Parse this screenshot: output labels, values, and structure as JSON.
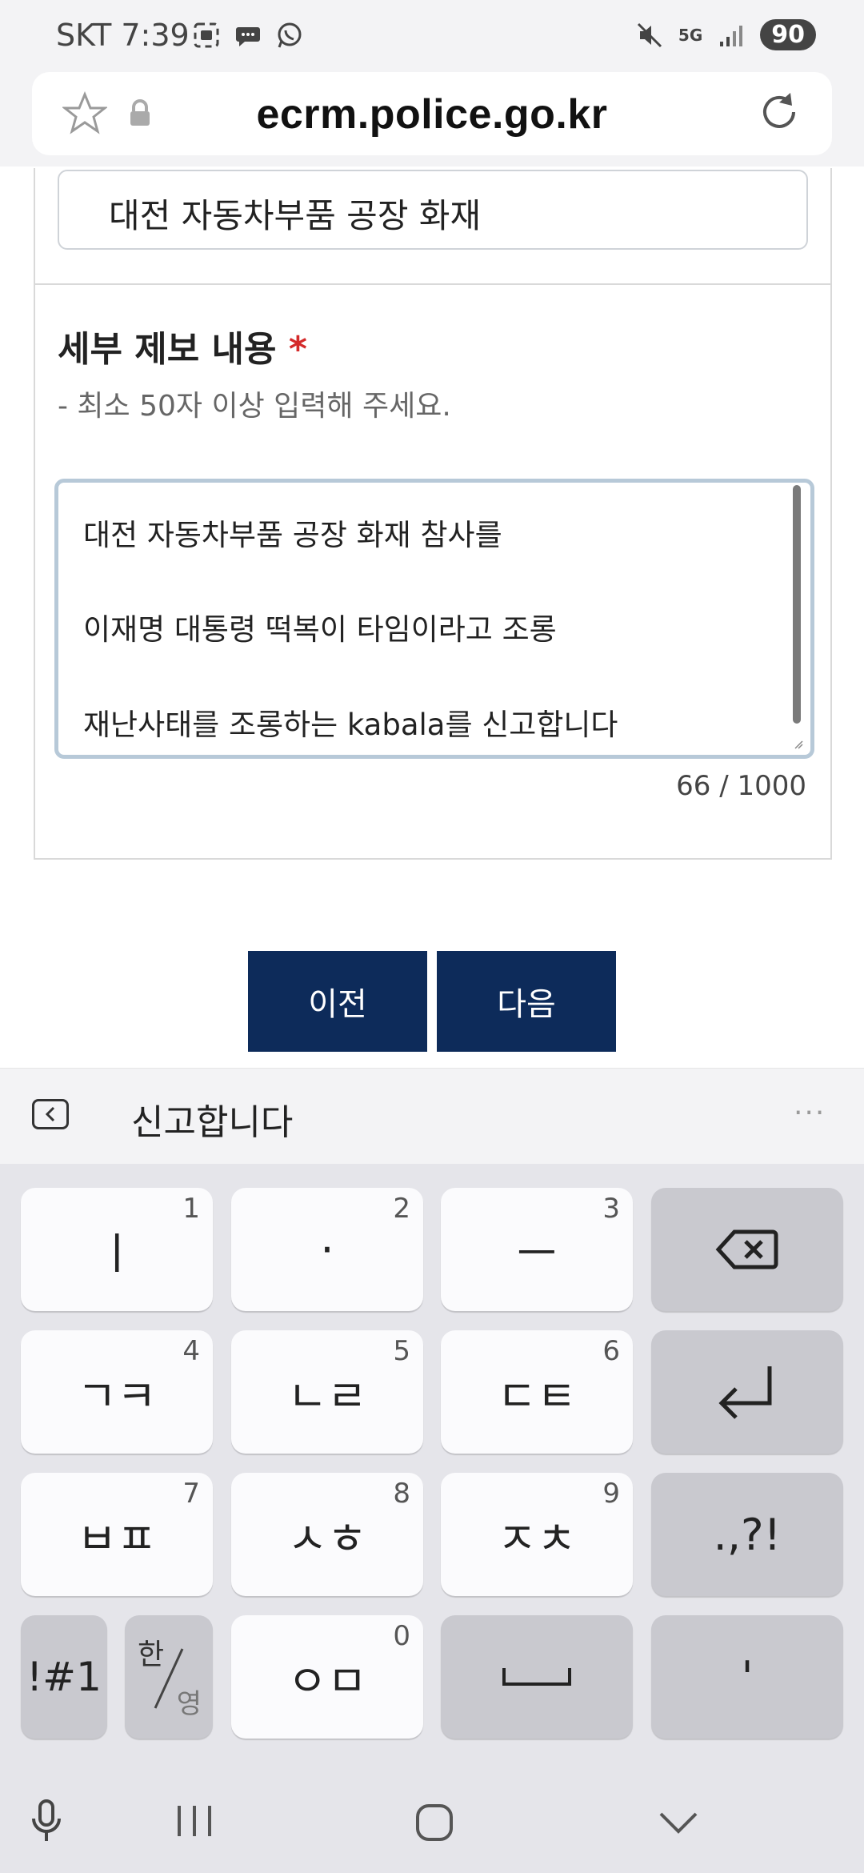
{
  "status_bar": {
    "carrier_time": "SKT 7:39",
    "battery": "90",
    "network": "5G"
  },
  "browser": {
    "url": "ecrm.police.go.kr"
  },
  "form": {
    "title_value": "대전 자동차부품 공장 화재",
    "detail_label": "세부 제보 내용",
    "required_mark": "*",
    "hint": "- 최소 50자 이상 입력해 주세요.",
    "detail_lines": [
      "대전 자동차부품 공장 화재 참사를",
      "이재명 대통령 떡복이 타임이라고 조롱",
      "재난사태를 조롱하는 kabala를 신고합니다"
    ],
    "char_count": "66",
    "char_separator": "/",
    "char_limit": "1000",
    "prev_button": "이전",
    "next_button": "다음"
  },
  "keyboard": {
    "suggestion": "신고합니다",
    "keys": [
      {
        "label": "ㅣ",
        "num": "1"
      },
      {
        "label": "·",
        "num": "2"
      },
      {
        "label": "ㅡ",
        "num": "3"
      },
      {
        "label": "ㄱㅋ",
        "num": "4"
      },
      {
        "label": "ㄴㄹ",
        "num": "5"
      },
      {
        "label": "ㄷㅌ",
        "num": "6"
      },
      {
        "label": "ㅂㅍ",
        "num": "7"
      },
      {
        "label": "ㅅㅎ",
        "num": "8"
      },
      {
        "label": "ㅈㅊ",
        "num": "9"
      },
      {
        "label": "ㅇㅁ",
        "num": "0"
      }
    ],
    "punct_key": ".,?!",
    "symbols_key": "!#1",
    "lang_key_top": "한",
    "lang_key_bottom": "영",
    "apostrophe_key": "'"
  }
}
